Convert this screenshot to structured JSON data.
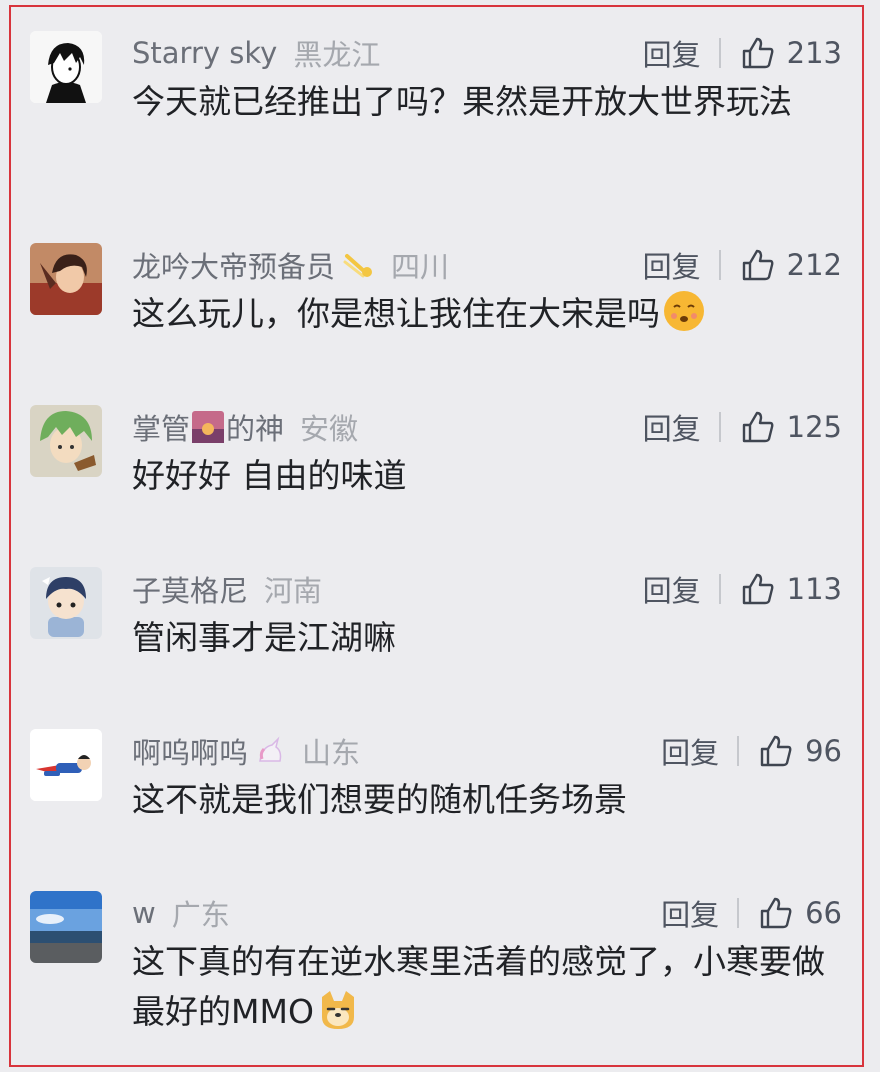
{
  "comments": [
    {
      "username": "Starry sky",
      "location": "黑龙江",
      "reply_label": "回复",
      "likes": "213",
      "text": "今天就已经推出了吗？果然是开放大世界玩法",
      "avatar": "boy-portrait-avatar"
    },
    {
      "username": "龙吟大帝预备员",
      "location": "四川",
      "reply_label": "回复",
      "likes": "212",
      "text": "这么玩儿，你是想让我住在大宋是吗",
      "avatar": "anime-girl-avatar",
      "badge": "star-badge-icon",
      "text_emoji": "pout-face-emoji"
    },
    {
      "username": "掌管",
      "username_suffix": "的神",
      "location": "安徽",
      "reply_label": "回复",
      "likes": "125",
      "text": "好好好 自由的味道",
      "avatar": "green-hair-anime-avatar",
      "name_emoji": "sunset-emoji"
    },
    {
      "username": "子莫格尼",
      "location": "河南",
      "reply_label": "回复",
      "likes": "113",
      "text": "管闲事才是江湖嘛",
      "avatar": "chibi-doll-avatar"
    },
    {
      "username": "啊呜啊呜",
      "location": "山东",
      "reply_label": "回复",
      "likes": "96",
      "text": "这不就是我们想要的随机任务场景",
      "avatar": "flying-hero-avatar",
      "badge": "unicorn-badge-icon"
    },
    {
      "username": "w",
      "location": "广东",
      "reply_label": "回复",
      "likes": "66",
      "text": "这下真的有在逆水寒里活着的感觉了，小寒要做最好的MMO",
      "avatar": "beach-sky-avatar",
      "text_emoji": "doge-emoji"
    }
  ],
  "colors": {
    "border": "#d8343c",
    "background": "#ececef",
    "username": "#6b6f78",
    "location": "#a5a8ae",
    "text": "#202226"
  }
}
